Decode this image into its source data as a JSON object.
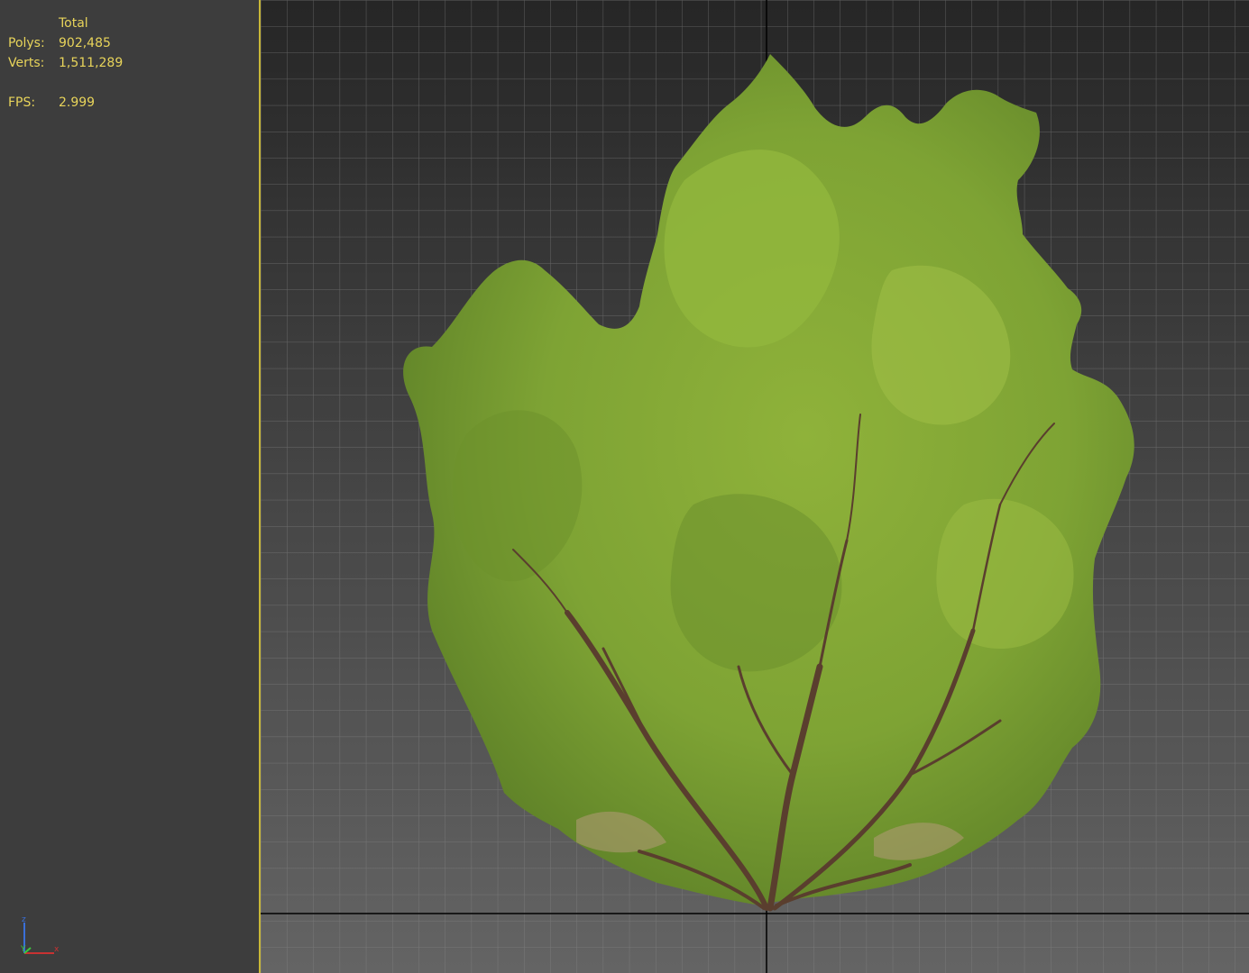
{
  "stats": {
    "header": "Total",
    "rows": [
      {
        "label": "Polys:",
        "value": "902,485"
      },
      {
        "label": "Verts:",
        "value": "1,511,289"
      }
    ],
    "fps": {
      "label": "FPS:",
      "value": "2.999"
    },
    "text_color": "#e8d45a"
  },
  "axis": {
    "z_label": "z",
    "y_label": "Y",
    "x_label": "x"
  },
  "viewport": {
    "background_top": "#262626",
    "background_bottom": "#646464",
    "grid_color": "#8a8a8a",
    "axis_line_color": "#000000",
    "active_border_color": "#c9b838",
    "object": "shrub-tree-model"
  }
}
